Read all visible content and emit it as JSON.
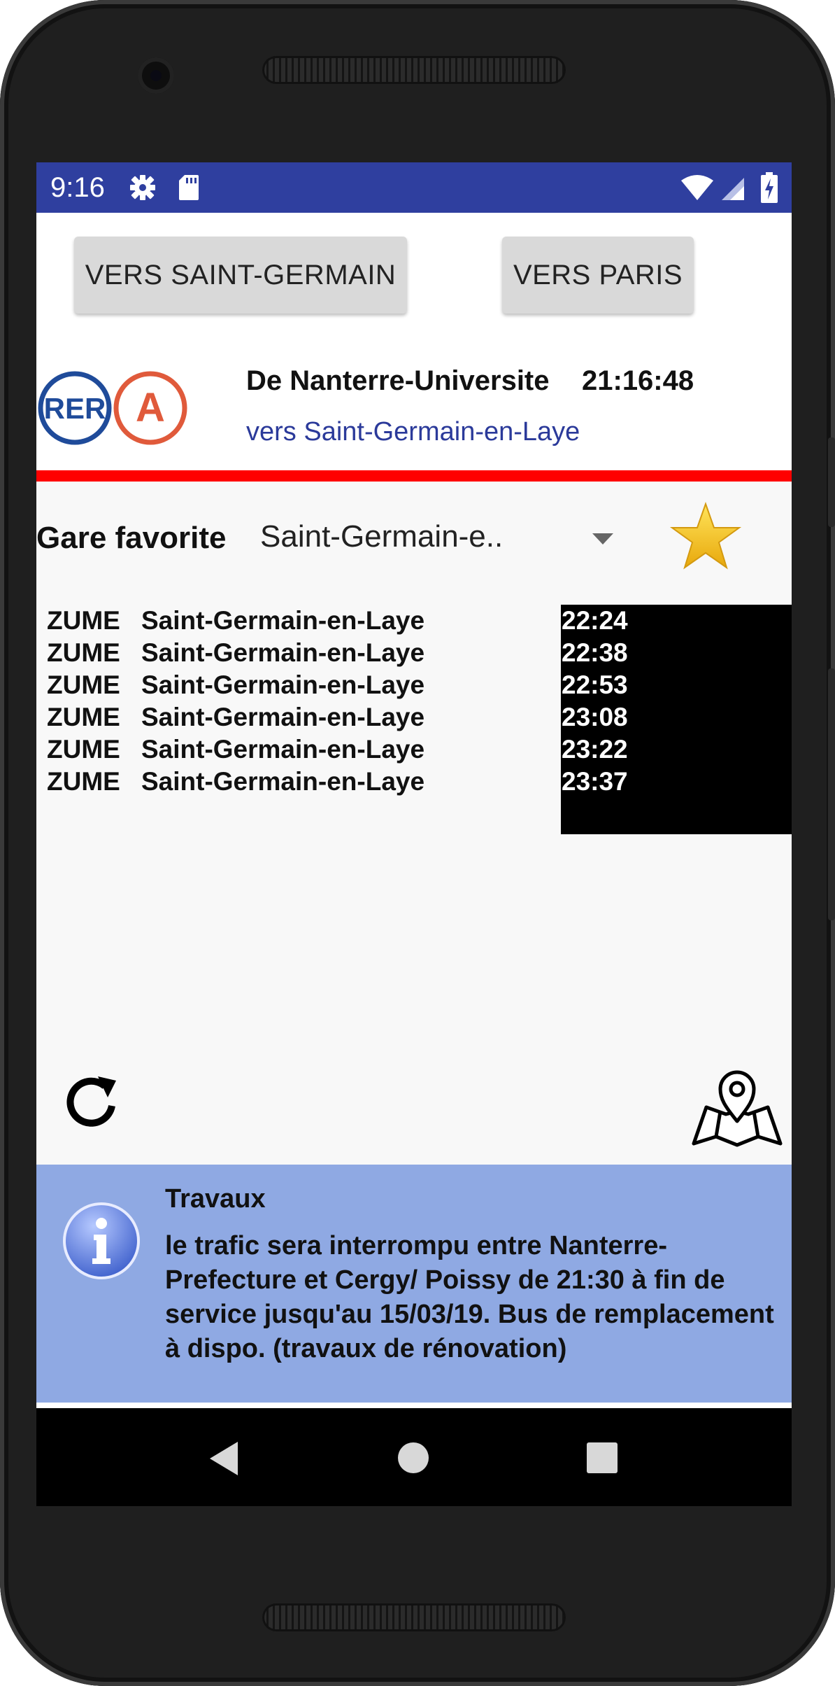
{
  "status_bar": {
    "time": "9:16",
    "icons": [
      "gear-icon",
      "sd-card-icon",
      "wifi-icon",
      "signal-icon",
      "battery-charging-icon"
    ]
  },
  "actions": {
    "toward_saint_germain": "VERS SAINT-GERMAIN",
    "toward_paris": "VERS PARIS"
  },
  "header": {
    "rer_logo_text": "RER",
    "line_letter": "A",
    "station": "De Nanterre-Universite",
    "clock": "21:16:48",
    "direction": "vers Saint-Germain-en-Laye"
  },
  "favorite": {
    "label": "Gare favorite",
    "selected": "Saint-Germain-e.."
  },
  "departures": [
    {
      "code": "ZUME",
      "destination": "Saint-Germain-en-Laye",
      "time": "22:24"
    },
    {
      "code": "ZUME",
      "destination": "Saint-Germain-en-Laye",
      "time": "22:38"
    },
    {
      "code": "ZUME",
      "destination": "Saint-Germain-en-Laye",
      "time": "22:53"
    },
    {
      "code": "ZUME",
      "destination": "Saint-Germain-en-Laye",
      "time": "23:08"
    },
    {
      "code": "ZUME",
      "destination": "Saint-Germain-en-Laye",
      "time": "23:22"
    },
    {
      "code": "ZUME",
      "destination": "Saint-Germain-en-Laye",
      "time": "23:37"
    }
  ],
  "info": {
    "title": "Travaux",
    "message": "le trafic sera interrompu entre Nanterre-Prefecture et Cergy/ Poissy de 21:30 à fin de service jusqu'au 15/03/19. Bus de remplacement à dispo. (travaux de rénovation)"
  },
  "colors": {
    "status_bar": "#2f3f9f",
    "rer_blue": "#1f4b9a",
    "line_a_red": "#e05a3b",
    "separator_red": "#ff0000",
    "direction_text": "#2b3a9a",
    "info_background": "#8fa9e3",
    "star_gold": "#f4c21a"
  },
  "navigation": {
    "icons": [
      "back-icon",
      "home-icon",
      "recents-icon"
    ]
  }
}
